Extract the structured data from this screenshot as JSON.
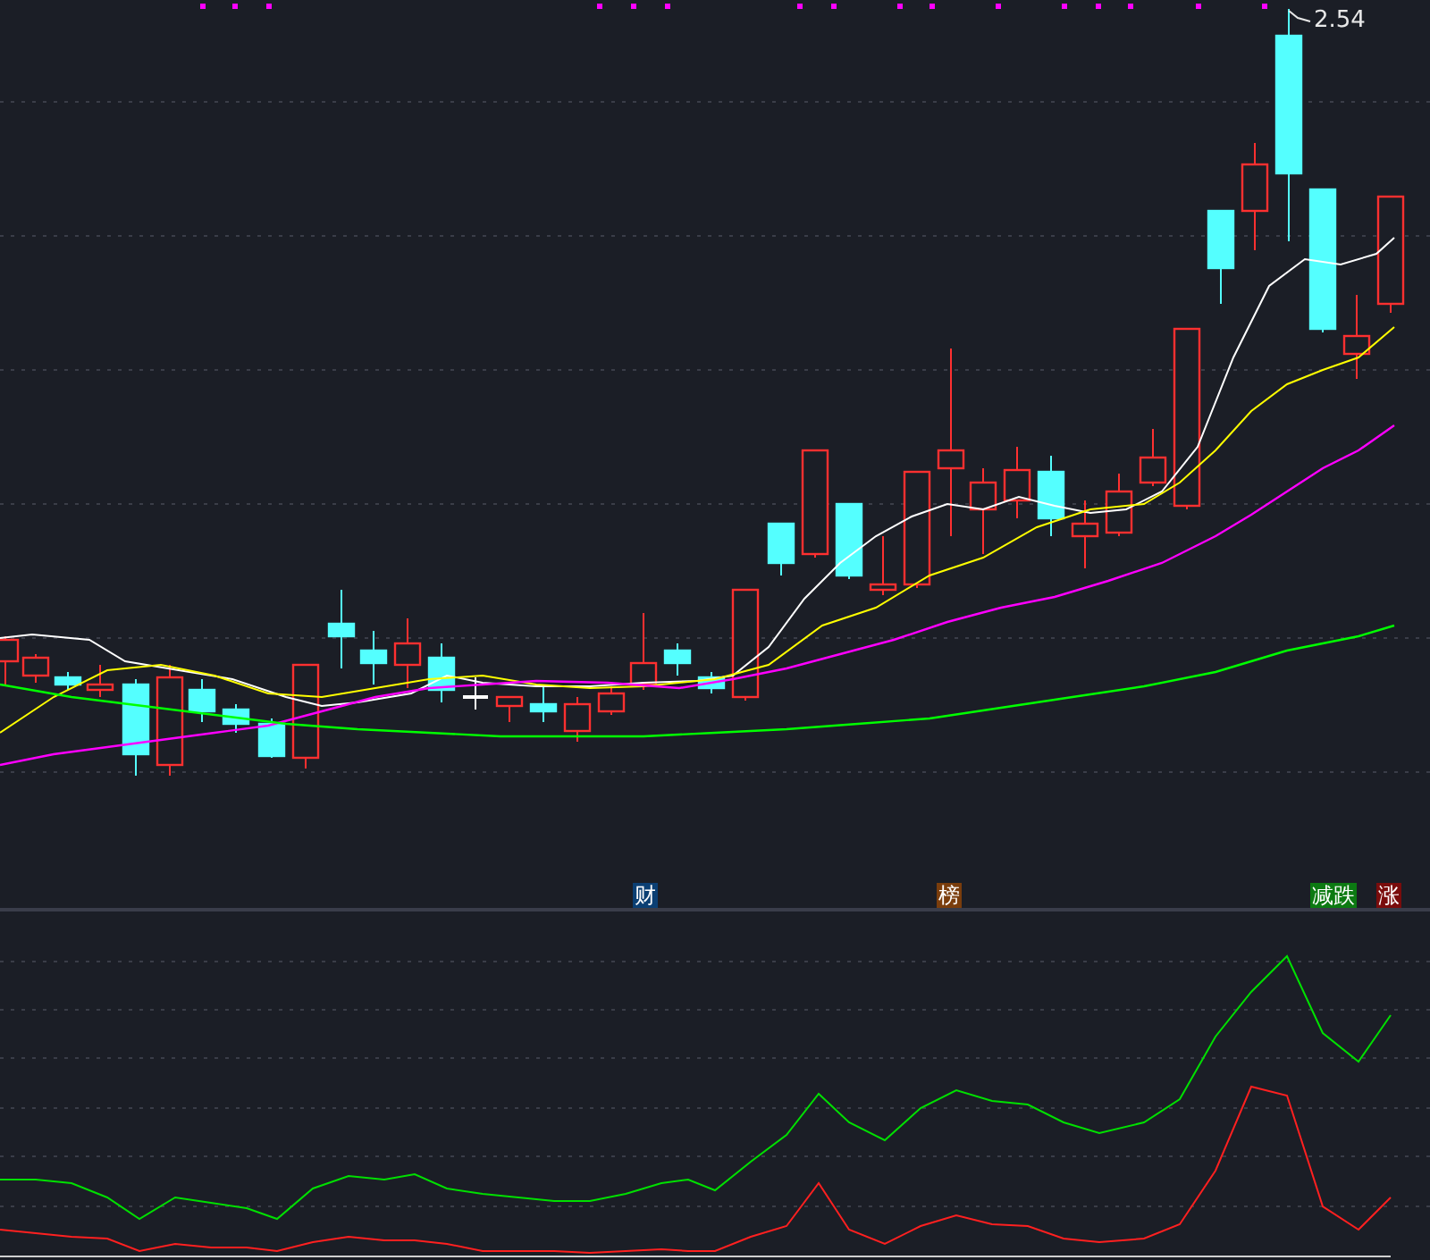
{
  "main_chart": {
    "high_label": "2.54"
  },
  "markers": [
    {
      "text": "财",
      "color": "#0b3f73"
    },
    {
      "text": "榜",
      "color": "#7a3d0c"
    },
    {
      "text": "减跌",
      "color": "#0c7a12"
    },
    {
      "text": "涨",
      "color": "#7a0c0c"
    }
  ]
}
